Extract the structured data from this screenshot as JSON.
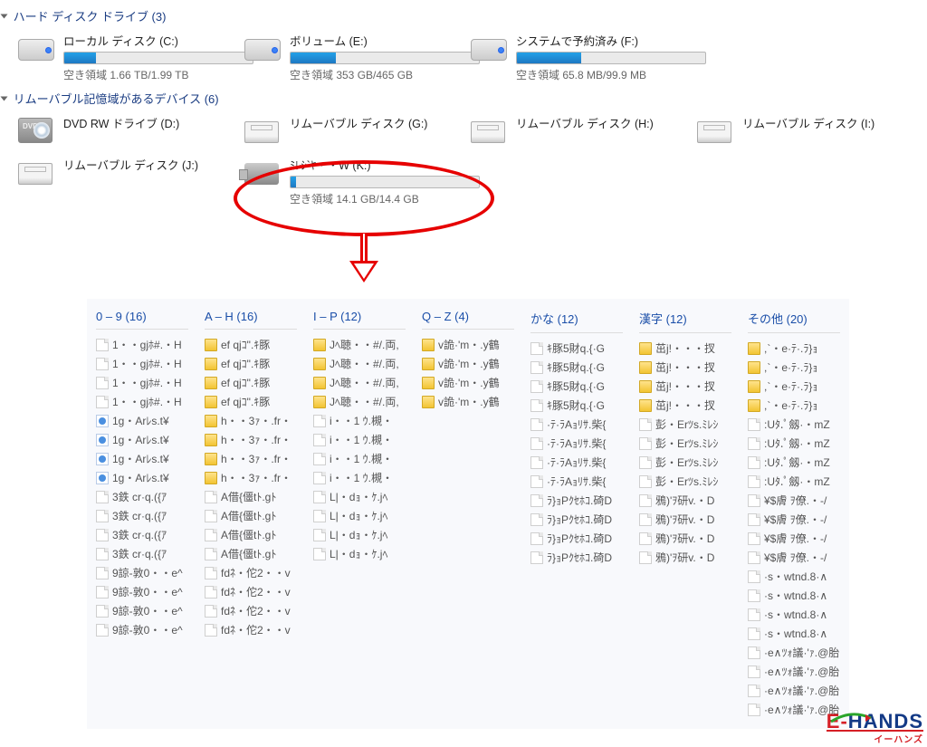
{
  "sections": {
    "hdd": {
      "title": "ハード ディスク ドライブ (3)"
    },
    "removable": {
      "title": "リムーバブル記憶域があるデバイス (6)"
    }
  },
  "drives": {
    "c": {
      "name": "ローカル ディスク (C:)",
      "sub": "空き領域 1.66 TB/1.99 TB",
      "fill_pct": 17
    },
    "e": {
      "name": "ボリューム (E:)",
      "sub": "空き領域 353 GB/465 GB",
      "fill_pct": 24
    },
    "f": {
      "name": "システムで予約済み (F:)",
      "sub": "空き領域 65.8 MB/99.9 MB",
      "fill_pct": 34
    },
    "d": {
      "name": "DVD RW ドライブ (D:)"
    },
    "g": {
      "name": "リムーバブル ディスク (G:)"
    },
    "h": {
      "name": "リムーバブル ディスク (H:)"
    },
    "i": {
      "name": "リムーバブル ディスク (I:)"
    },
    "j": {
      "name": "リムーバブル ディスク (J:)"
    },
    "k": {
      "name": "ﾐﾚｼ`ﾔ・・W (K:)",
      "sub": "空き領域 14.1 GB/14.4 GB",
      "fill_pct": 3
    }
  },
  "columns": [
    {
      "header": "0 – 9 (16)",
      "items": [
        {
          "icon": "page",
          "t": "1・・gjﾎ#.・H"
        },
        {
          "icon": "page",
          "t": "1・・gjﾎ#.・H"
        },
        {
          "icon": "page",
          "t": "1・・gjﾎ#.・H"
        },
        {
          "icon": "page",
          "t": "1・・gjﾎ#.・H"
        },
        {
          "icon": "media",
          "t": "1g・Arﾚs.t¥"
        },
        {
          "icon": "media",
          "t": "1g・Arﾚs.t¥"
        },
        {
          "icon": "media",
          "t": "1g・Arﾚs.t¥"
        },
        {
          "icon": "media",
          "t": "1g・Arﾚs.t¥"
        },
        {
          "icon": "page",
          "t": "3鉄 cr·q.({ｱ"
        },
        {
          "icon": "page",
          "t": "3鉄 cr·q.({ｱ"
        },
        {
          "icon": "page",
          "t": "3鉄 cr·q.({ｱ"
        },
        {
          "icon": "page",
          "t": "3鉄 cr·q.({ｱ"
        },
        {
          "icon": "page",
          "t": "9諒-敦0・・e^"
        },
        {
          "icon": "page",
          "t": "9諒-敦0・・e^"
        },
        {
          "icon": "page",
          "t": "9諒-敦0・・e^"
        },
        {
          "icon": "page",
          "t": "9諒-敦0・・e^"
        }
      ]
    },
    {
      "header": "A – H (16)",
      "items": [
        {
          "icon": "folder",
          "t": "ef  qjｺ\".ｷ豚"
        },
        {
          "icon": "folder",
          "t": "ef  qjｺ\".ｷ豚"
        },
        {
          "icon": "folder",
          "t": "ef  qjｺ\".ｷ豚"
        },
        {
          "icon": "folder",
          "t": "ef  qjｺ\".ｷ豚"
        },
        {
          "icon": "folder",
          "t": "h・・3ｧ・.fr・"
        },
        {
          "icon": "folder",
          "t": "h・・3ｧ・.fr・"
        },
        {
          "icon": "folder",
          "t": "h・・3ｧ・.fr・"
        },
        {
          "icon": "folder",
          "t": "h・・3ｧ・.fr・"
        },
        {
          "icon": "page",
          "t": "A借{僵tﾄ.gﾄ"
        },
        {
          "icon": "page",
          "t": "A借{僵tﾄ.gﾄ"
        },
        {
          "icon": "page",
          "t": "A借{僵tﾄ.gﾄ"
        },
        {
          "icon": "page",
          "t": "A借{僵tﾄ.gﾄ"
        },
        {
          "icon": "page",
          "t": "fdﾈ・佗2・・v"
        },
        {
          "icon": "page",
          "t": "fdﾈ・佗2・・v"
        },
        {
          "icon": "page",
          "t": "fdﾈ・佗2・・v"
        },
        {
          "icon": "page",
          "t": "fdﾈ・佗2・・v"
        }
      ]
    },
    {
      "header": "I – P (12)",
      "items": [
        {
          "icon": "folder",
          "t": "Jﾍ聴・・#/.両,"
        },
        {
          "icon": "folder",
          "t": "Jﾍ聴・・#/.両,"
        },
        {
          "icon": "folder",
          "t": "Jﾍ聴・・#/.両,"
        },
        {
          "icon": "folder",
          "t": "Jﾍ聴・・#/.両,"
        },
        {
          "icon": "page",
          "t": "i・・1 ｳ.槻・"
        },
        {
          "icon": "page",
          "t": "i・・1 ｳ.槻・"
        },
        {
          "icon": "page",
          "t": "i・・1 ｳ.槻・"
        },
        {
          "icon": "page",
          "t": "i・・1 ｳ.槻・"
        },
        {
          "icon": "page",
          "t": "L|・dｮ・ｹ.jﾍ"
        },
        {
          "icon": "page",
          "t": "L|・dｮ・ｹ.jﾍ"
        },
        {
          "icon": "page",
          "t": "L|・dｮ・ｹ.jﾍ"
        },
        {
          "icon": "page",
          "t": "L|・dｮ・ｹ.jﾍ"
        }
      ]
    },
    {
      "header": "Q – Z (4)",
      "items": [
        {
          "icon": "folder",
          "t": "v詭·'m・.y鶴"
        },
        {
          "icon": "folder",
          "t": "v詭·'m・.y鶴"
        },
        {
          "icon": "folder",
          "t": "v詭·'m・.y鶴"
        },
        {
          "icon": "folder",
          "t": "v詭·'m・.y鶴"
        }
      ]
    },
    {
      "header": "かな (12)",
      "items": [
        {
          "icon": "page",
          "t": "ｷ豚5財q.{·G"
        },
        {
          "icon": "page",
          "t": "ｷ豚5財q.{·G"
        },
        {
          "icon": "page",
          "t": "ｷ豚5財q.{·G"
        },
        {
          "icon": "page",
          "t": "ｷ豚5財q.{·G"
        },
        {
          "icon": "page",
          "t": "·ﾃ·ﾗAｮﾘｻ.柴{"
        },
        {
          "icon": "page",
          "t": "·ﾃ·ﾗAｮﾘｻ.柴{"
        },
        {
          "icon": "page",
          "t": "·ﾃ·ﾗAｮﾘｻ.柴{"
        },
        {
          "icon": "page",
          "t": "·ﾃ·ﾗAｮﾘｻ.柴{"
        },
        {
          "icon": "page",
          "t": "ﾗ}ｮPｸｾﾎｺ.碕D"
        },
        {
          "icon": "page",
          "t": "ﾗ}ｮPｸｾﾎｺ.碕D"
        },
        {
          "icon": "page",
          "t": "ﾗ}ｮPｸｾﾎｺ.碕D"
        },
        {
          "icon": "page",
          "t": "ﾗ}ｮPｸｾﾎｺ.碕D"
        }
      ]
    },
    {
      "header": "漢字 (12)",
      "items": [
        {
          "icon": "folder",
          "t": "茁j!・・・扠"
        },
        {
          "icon": "folder",
          "t": "茁j!・・・扠"
        },
        {
          "icon": "folder",
          "t": "茁j!・・・扠"
        },
        {
          "icon": "folder",
          "t": "茁j!・・・扠"
        },
        {
          "icon": "page",
          "t": "彭・Erﾂs.ﾐﾚｼ"
        },
        {
          "icon": "page",
          "t": "彭・Erﾂs.ﾐﾚｼ"
        },
        {
          "icon": "page",
          "t": "彭・Erﾂs.ﾐﾚｼ"
        },
        {
          "icon": "page",
          "t": "彭・Erﾂs.ﾐﾚｼ"
        },
        {
          "icon": "page",
          "t": "鴉)'ｦ研v.・D"
        },
        {
          "icon": "page",
          "t": "鴉)'ｦ研v.・D"
        },
        {
          "icon": "page",
          "t": "鴉)'ｦ研v.・D"
        },
        {
          "icon": "page",
          "t": "鴉)'ｦ研v.・D"
        }
      ]
    },
    {
      "header": "その他 (20)",
      "items": [
        {
          "icon": "folder",
          "t": ",`・e·ﾃ·.ﾗ}ｮ"
        },
        {
          "icon": "folder",
          "t": ",`・e·ﾃ·.ﾗ}ｮ"
        },
        {
          "icon": "folder",
          "t": ",`・e·ﾃ·.ﾗ}ｮ"
        },
        {
          "icon": "folder",
          "t": ",`・e·ﾃ·.ﾗ}ｮ"
        },
        {
          "icon": "page",
          "t": ":Uﾀ.ﾟ劔·・mZ"
        },
        {
          "icon": "page",
          "t": ":Uﾀ.ﾟ劔·・mZ"
        },
        {
          "icon": "page",
          "t": ":Uﾀ.ﾟ劔·・mZ"
        },
        {
          "icon": "page",
          "t": ":Uﾀ.ﾟ劔·・mZ"
        },
        {
          "icon": "page",
          "t": "¥$膚 ｦ僚.・-/"
        },
        {
          "icon": "page",
          "t": "¥$膚 ｦ僚.・-/"
        },
        {
          "icon": "page",
          "t": "¥$膚 ｦ僚.・-/"
        },
        {
          "icon": "page",
          "t": "¥$膚 ｦ僚.・-/"
        },
        {
          "icon": "page",
          "t": "·s・wtnd.8·∧"
        },
        {
          "icon": "page",
          "t": "·s・wtnd.8·∧"
        },
        {
          "icon": "page",
          "t": "·s・wtnd.8·∧"
        },
        {
          "icon": "page",
          "t": "·s・wtnd.8·∧"
        },
        {
          "icon": "page",
          "t": "·e∧ﾂｫ議·'ｧ.@胎"
        },
        {
          "icon": "page",
          "t": "·e∧ﾂｫ議·'ｧ.@胎"
        },
        {
          "icon": "page",
          "t": "·e∧ﾂｫ議·'ｧ.@胎"
        },
        {
          "icon": "page",
          "t": "·e∧ﾂｫ議·'ｧ.@胎"
        }
      ]
    }
  ],
  "logo": {
    "main1": "E-",
    "main2": "HANDS",
    "sub": "イーハンズ"
  }
}
